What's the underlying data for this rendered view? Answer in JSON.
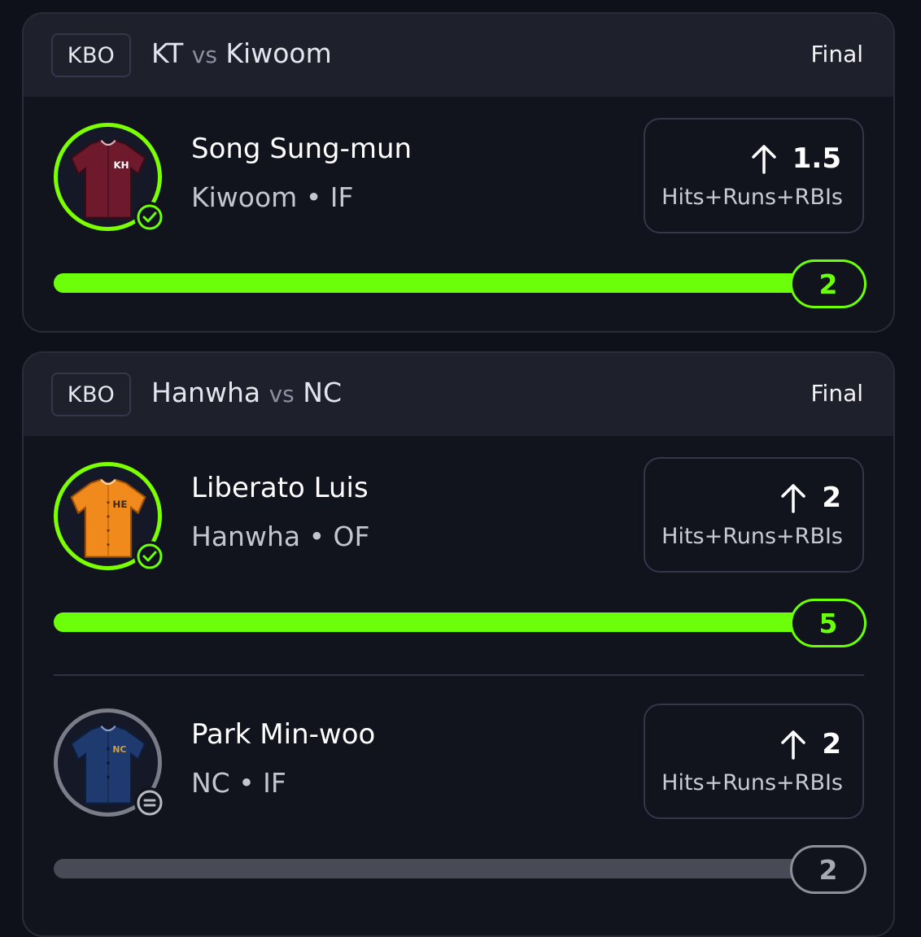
{
  "games": [
    {
      "league": "KBO",
      "home": "KT",
      "vs": "vs",
      "away": "Kiwoom",
      "status": "Final",
      "players": [
        {
          "name": "Song Sung-mun",
          "team": "Kiwoom",
          "position": "IF",
          "meta": "Kiwoom • IF",
          "jersey_icon": "jersey-icon",
          "jersey_text": "KH",
          "jersey_color": "#6e1a2c",
          "result_icon": "check-circle-icon",
          "direction_icon": "arrow-up-icon",
          "line": "1.5",
          "stat": "Hits+Runs+RBIs",
          "actual": "2",
          "progress": 1.0,
          "hit": true
        }
      ]
    },
    {
      "league": "KBO",
      "home": "Hanwha",
      "vs": "vs",
      "away": "NC",
      "status": "Final",
      "players": [
        {
          "name": "Liberato Luis",
          "team": "Hanwha",
          "position": "OF",
          "meta": "Hanwha • OF",
          "jersey_icon": "jersey-icon",
          "jersey_text": "HE",
          "jersey_color": "#f08a1c",
          "result_icon": "check-circle-icon",
          "direction_icon": "arrow-up-icon",
          "line": "2",
          "stat": "Hits+Runs+RBIs",
          "actual": "5",
          "progress": 1.0,
          "hit": true
        },
        {
          "name": "Park Min-woo",
          "team": "NC",
          "position": "IF",
          "meta": "NC • IF",
          "jersey_icon": "jersey-icon",
          "jersey_text": "NC",
          "jersey_color": "#1f3a6e",
          "result_icon": "push-circle-icon",
          "direction_icon": "arrow-up-icon",
          "line": "2",
          "stat": "Hits+Runs+RBIs",
          "actual": "2",
          "progress": 0.0,
          "hit": false
        }
      ]
    }
  ],
  "colors": {
    "accent_green": "#6bff0a",
    "background": "#0f111a",
    "header": "#1e202b",
    "neutral": "#8d909a"
  }
}
